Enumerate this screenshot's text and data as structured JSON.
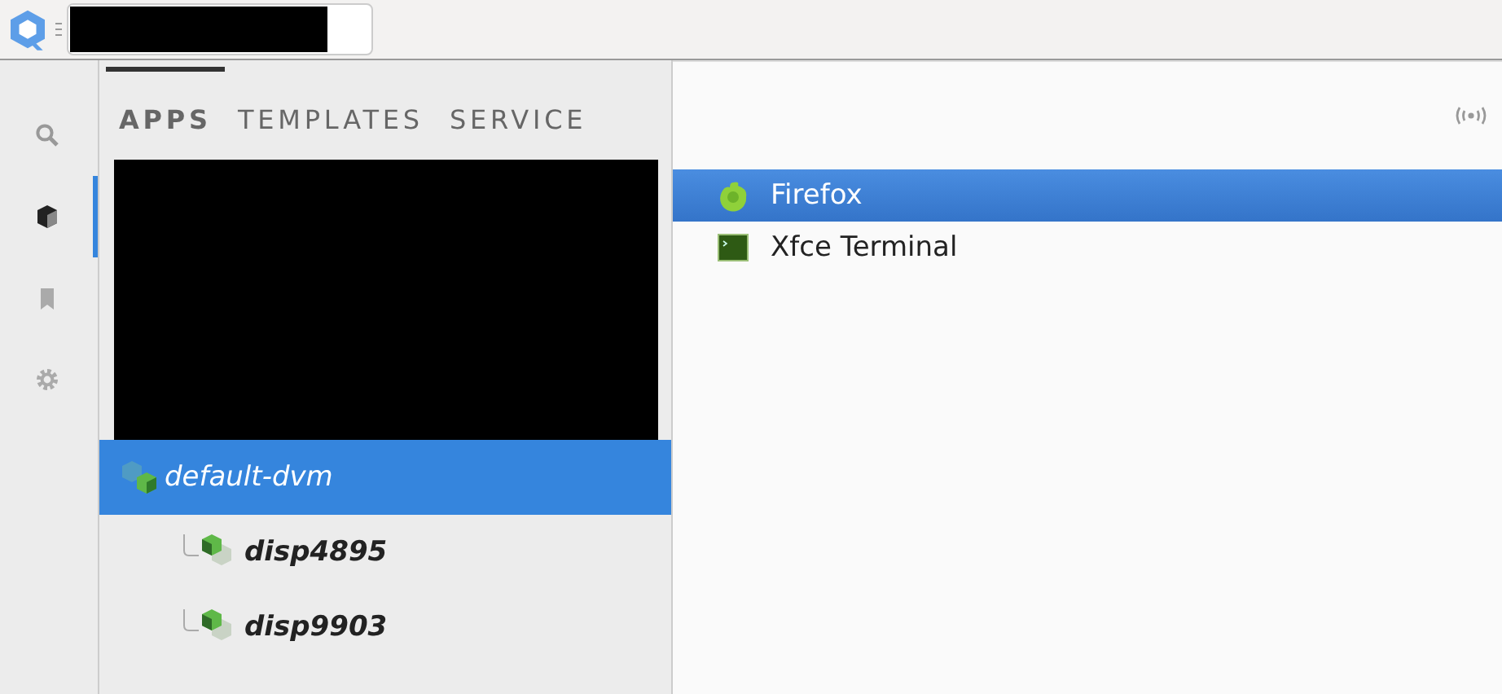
{
  "sidebar": {
    "items": [
      {
        "kind": "search",
        "selected": false
      },
      {
        "kind": "cube",
        "selected": true
      },
      {
        "kind": "bookmark",
        "selected": false
      },
      {
        "kind": "settings",
        "selected": false
      }
    ]
  },
  "tabs": [
    {
      "label": "APPS",
      "selected": true
    },
    {
      "label": "TEMPLATES",
      "selected": false
    },
    {
      "label": "SERVICE",
      "selected": false
    }
  ],
  "vms": [
    {
      "name": "default-dvm",
      "selected": true,
      "children": [
        {
          "name": "disp4895",
          "selected": false
        },
        {
          "name": "disp9903",
          "selected": false
        }
      ]
    }
  ],
  "apps": [
    {
      "name": "Firefox",
      "kind": "firefox",
      "selected": true
    },
    {
      "name": "Xfce Terminal",
      "kind": "terminal",
      "selected": false
    }
  ]
}
